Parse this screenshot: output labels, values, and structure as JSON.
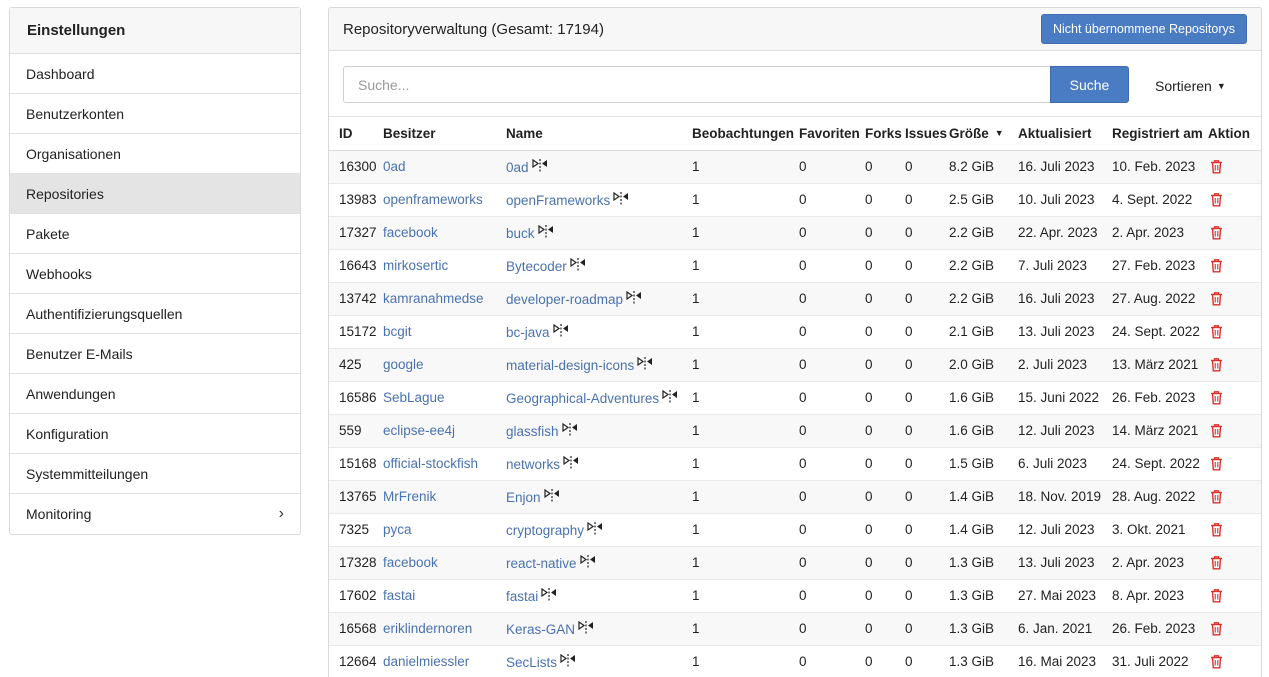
{
  "sidebar": {
    "title": "Einstellungen",
    "items": [
      {
        "label": "Dashboard",
        "active": false
      },
      {
        "label": "Benutzerkonten",
        "active": false
      },
      {
        "label": "Organisationen",
        "active": false
      },
      {
        "label": "Repositories",
        "active": true
      },
      {
        "label": "Pakete",
        "active": false
      },
      {
        "label": "Webhooks",
        "active": false
      },
      {
        "label": "Authentifizierungsquellen",
        "active": false
      },
      {
        "label": "Benutzer E-Mails",
        "active": false
      },
      {
        "label": "Anwendungen",
        "active": false
      },
      {
        "label": "Konfiguration",
        "active": false
      },
      {
        "label": "Systemmitteilungen",
        "active": false
      },
      {
        "label": "Monitoring",
        "active": false,
        "expandable": true
      }
    ]
  },
  "main": {
    "title": "Repositoryverwaltung (Gesamt: 17194)",
    "unadopted_label": "Nicht übernommene Repositorys",
    "search": {
      "placeholder": "Suche...",
      "value": "",
      "button_label": "Suche"
    },
    "sort_label": "Sortieren"
  },
  "table": {
    "headers": {
      "id": "ID",
      "owner": "Besitzer",
      "name": "Name",
      "watch": "Beobachtungen",
      "fav": "Favoriten",
      "forks": "Forks",
      "issues": "Issues",
      "size": "Größe",
      "updated": "Aktualisiert",
      "registered": "Registriert am",
      "action": "Aktion"
    },
    "rows": [
      {
        "id": "16300",
        "owner": "0ad",
        "name": "0ad",
        "watch": "1",
        "fav": "0",
        "forks": "0",
        "issues": "0",
        "size": "8.2 GiB",
        "updated": "16. Juli 2023",
        "registered": "10. Feb. 2023"
      },
      {
        "id": "13983",
        "owner": "openframeworks",
        "name": "openFrameworks",
        "watch": "1",
        "fav": "0",
        "forks": "0",
        "issues": "0",
        "size": "2.5 GiB",
        "updated": "10. Juli 2023",
        "registered": "4. Sept. 2022"
      },
      {
        "id": "17327",
        "owner": "facebook",
        "name": "buck",
        "watch": "1",
        "fav": "0",
        "forks": "0",
        "issues": "0",
        "size": "2.2 GiB",
        "updated": "22. Apr. 2023",
        "registered": "2. Apr. 2023"
      },
      {
        "id": "16643",
        "owner": "mirkosertic",
        "name": "Bytecoder",
        "watch": "1",
        "fav": "0",
        "forks": "0",
        "issues": "0",
        "size": "2.2 GiB",
        "updated": "7. Juli 2023",
        "registered": "27. Feb. 2023"
      },
      {
        "id": "13742",
        "owner": "kamranahmedse",
        "name": "developer-roadmap",
        "watch": "1",
        "fav": "0",
        "forks": "0",
        "issues": "0",
        "size": "2.2 GiB",
        "updated": "16. Juli 2023",
        "registered": "27. Aug. 2022"
      },
      {
        "id": "15172",
        "owner": "bcgit",
        "name": "bc-java",
        "watch": "1",
        "fav": "0",
        "forks": "0",
        "issues": "0",
        "size": "2.1 GiB",
        "updated": "13. Juli 2023",
        "registered": "24. Sept. 2022"
      },
      {
        "id": "425",
        "owner": "google",
        "name": "material-design-icons",
        "watch": "1",
        "fav": "0",
        "forks": "0",
        "issues": "0",
        "size": "2.0 GiB",
        "updated": "2. Juli 2023",
        "registered": "13. März 2021"
      },
      {
        "id": "16586",
        "owner": "SebLague",
        "name": "Geographical-Adventures",
        "watch": "1",
        "fav": "0",
        "forks": "0",
        "issues": "0",
        "size": "1.6 GiB",
        "updated": "15. Juni 2022",
        "registered": "26. Feb. 2023"
      },
      {
        "id": "559",
        "owner": "eclipse-ee4j",
        "name": "glassfish",
        "watch": "1",
        "fav": "0",
        "forks": "0",
        "issues": "0",
        "size": "1.6 GiB",
        "updated": "12. Juli 2023",
        "registered": "14. März 2021"
      },
      {
        "id": "15168",
        "owner": "official-stockfish",
        "name": "networks",
        "watch": "1",
        "fav": "0",
        "forks": "0",
        "issues": "0",
        "size": "1.5 GiB",
        "updated": "6. Juli 2023",
        "registered": "24. Sept. 2022"
      },
      {
        "id": "13765",
        "owner": "MrFrenik",
        "name": "Enjon",
        "watch": "1",
        "fav": "0",
        "forks": "0",
        "issues": "0",
        "size": "1.4 GiB",
        "updated": "18. Nov. 2019",
        "registered": "28. Aug. 2022"
      },
      {
        "id": "7325",
        "owner": "pyca",
        "name": "cryptography",
        "watch": "1",
        "fav": "0",
        "forks": "0",
        "issues": "0",
        "size": "1.4 GiB",
        "updated": "12. Juli 2023",
        "registered": "3. Okt. 2021"
      },
      {
        "id": "17328",
        "owner": "facebook",
        "name": "react-native",
        "watch": "1",
        "fav": "0",
        "forks": "0",
        "issues": "0",
        "size": "1.3 GiB",
        "updated": "13. Juli 2023",
        "registered": "2. Apr. 2023"
      },
      {
        "id": "17602",
        "owner": "fastai",
        "name": "fastai",
        "watch": "1",
        "fav": "0",
        "forks": "0",
        "issues": "0",
        "size": "1.3 GiB",
        "updated": "27. Mai 2023",
        "registered": "8. Apr. 2023"
      },
      {
        "id": "16568",
        "owner": "eriklindernoren",
        "name": "Keras-GAN",
        "watch": "1",
        "fav": "0",
        "forks": "0",
        "issues": "0",
        "size": "1.3 GiB",
        "updated": "6. Jan. 2021",
        "registered": "26. Feb. 2023"
      },
      {
        "id": "12664",
        "owner": "danielmiessler",
        "name": "SecLists",
        "watch": "1",
        "fav": "0",
        "forks": "0",
        "issues": "0",
        "size": "1.3 GiB",
        "updated": "16. Mai 2023",
        "registered": "31. Juli 2022"
      }
    ]
  },
  "icons": {
    "mirror": "mirror-icon",
    "delete": "trash-icon",
    "chevron": "chevron-right-icon",
    "caret": "caret-down-icon"
  },
  "colors": {
    "accent": "#4a7cc4",
    "link": "#4a72b0",
    "danger": "#d9302a"
  }
}
